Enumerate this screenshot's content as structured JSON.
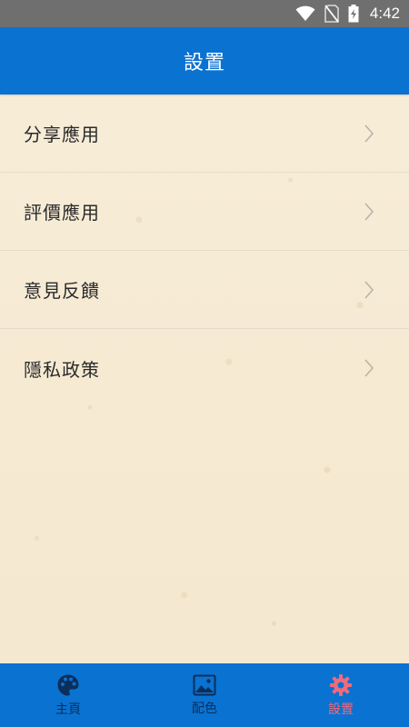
{
  "status_bar": {
    "time": "4:42",
    "icons": [
      "wifi-icon",
      "no-sim-icon",
      "battery-charging-icon"
    ]
  },
  "header": {
    "title": "設置"
  },
  "settings": {
    "items": [
      {
        "label": "分享應用",
        "icon": "chevron-right-icon"
      },
      {
        "label": "評價應用",
        "icon": "chevron-right-icon"
      },
      {
        "label": "意見反饋",
        "icon": "chevron-right-icon"
      },
      {
        "label": "隱私政策",
        "icon": "chevron-right-icon"
      }
    ]
  },
  "tab_bar": {
    "tabs": [
      {
        "label": "主頁",
        "icon": "palette-icon",
        "active": false
      },
      {
        "label": "配色",
        "icon": "image-icon",
        "active": false
      },
      {
        "label": "設置",
        "icon": "gear-icon",
        "active": true
      }
    ]
  },
  "colors": {
    "primary": "#0a72d1",
    "background": "#f6ead4",
    "active_tab": "#f06a7c",
    "inactive_tab": "#0b2f5a",
    "status_bar": "#6f6f6f"
  }
}
